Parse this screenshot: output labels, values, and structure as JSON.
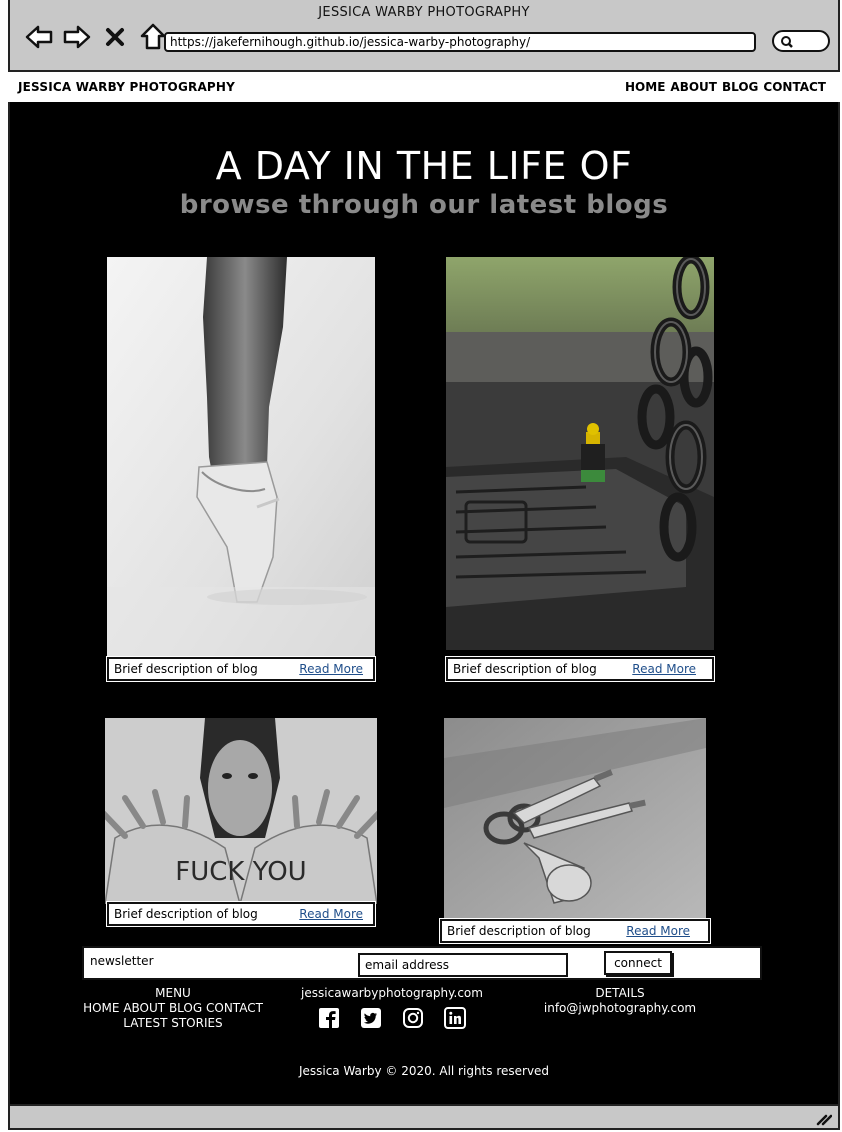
{
  "browser": {
    "window_title": "JESSICA WARBY PHOTOGRAPHY",
    "url": "https://jakefernihough.github.io/jessica-warby-photography/"
  },
  "nav": {
    "brand": "JESSICA WARBY PHOTOGRAPHY",
    "links": [
      "HOME",
      "ABOUT",
      "BLOG",
      "CONTACT"
    ]
  },
  "hero": {
    "title": "A DAY IN THE LIFE OF",
    "subtitle": "browse through our latest blogs"
  },
  "blogs": [
    {
      "description": "Brief description of blog",
      "link": "Read More",
      "image": "ballet-pointe-photo"
    },
    {
      "description": "Brief description of blog",
      "link": "Read More",
      "image": "chain-swing-lego-photo"
    },
    {
      "description": "Brief description of blog",
      "link": "Read More",
      "image": "hands-portrait-photo",
      "hand_text": "FUCK YOU"
    },
    {
      "description": "Brief description of blog",
      "link": "Read More",
      "image": "keys-photo"
    }
  ],
  "newsletter": {
    "label": "newsletter",
    "email_value": "email address",
    "button": "connect"
  },
  "footer": {
    "menu_heading": "MENU",
    "menu_links": [
      "HOME",
      "ABOUT",
      "BLOG",
      "CONTACT"
    ],
    "menu_extra": "LATEST STORIES",
    "site": "jessicawarbyphotography.com",
    "social_icons": [
      "facebook-icon",
      "twitter-icon",
      "instagram-icon",
      "linkedin-icon"
    ],
    "details_heading": "DETAILS",
    "email": "info@jwphotography.com",
    "copyright": "Jessica Warby © 2020. All rights reserved"
  },
  "colors": {
    "background": "#000000",
    "chrome": "#c8c8c8",
    "link": "#1f4e8a",
    "subtitle": "#8a8a8a"
  }
}
